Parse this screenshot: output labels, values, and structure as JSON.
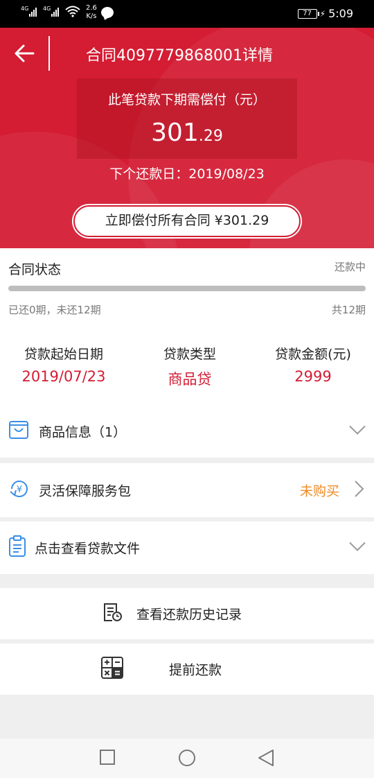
{
  "status_bar": {
    "signal1_tag": "4G",
    "signal2_tag": "4G",
    "net_speed_value": "2.6",
    "net_speed_unit": "K/s",
    "battery": "77",
    "time": "5:09"
  },
  "header": {
    "title": "合同4097779868001详情",
    "due_label": "此笔贷款下期需偿付（元）",
    "due_amount_int": "301",
    "due_amount_dec": ".29",
    "next_date": "下个还款日：2019/08/23",
    "pay_all_button": "立即偿付所有合同 ¥301.29"
  },
  "contract_status": {
    "title": "合同状态",
    "value": "还款中",
    "paid_text": "已还0期，未还12期",
    "total_text": "共12期",
    "progress": 0
  },
  "loan_info": [
    {
      "label": "贷款起始日期",
      "value": "2019/07/23"
    },
    {
      "label": "贷款类型",
      "value": "商品贷"
    },
    {
      "label": "贷款金额(元)",
      "value": "2999"
    }
  ],
  "sections": {
    "product_info": "商品信息（1）",
    "service_pack": "灵活保障服务包",
    "service_pack_status": "未购买",
    "loan_files": "点击查看贷款文件",
    "history": "查看还款历史记录",
    "prepay": "提前还款"
  },
  "colors": {
    "primary_red": "#d41c33",
    "orange": "#f08a24",
    "icon_blue": "#3a8ee6"
  }
}
